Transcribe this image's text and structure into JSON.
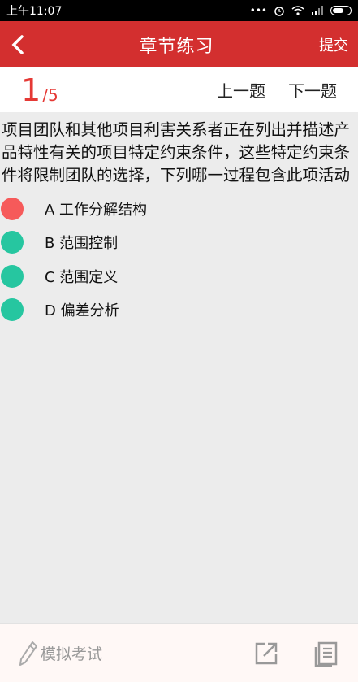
{
  "status": {
    "time": "上午11:07",
    "signal_dots": "•••"
  },
  "header": {
    "title": "章节练习",
    "submit_label": "提交",
    "back_icon": "chevron-left-icon"
  },
  "nav": {
    "current": "1",
    "separator": "/",
    "total": "5",
    "prev_label": "上一题",
    "next_label": "下一题"
  },
  "question": {
    "text": "项目团队和其他项目利害关系者正在列出并描述产品特性有关的项目特定约束条件，这些特定约束条件将限制团队的选择，下列哪一过程包含此项活动"
  },
  "options": [
    {
      "label": "A 工作分解结构",
      "selected": true
    },
    {
      "label": "B 范围控制",
      "selected": false
    },
    {
      "label": "C 范围定义",
      "selected": false
    },
    {
      "label": "D 偏差分析",
      "selected": false
    }
  ],
  "footer": {
    "mock_exam_label": "模拟考试",
    "share_icon": "share-icon",
    "list_icon": "list-icon"
  },
  "colors": {
    "primary": "#d32f2f",
    "option_default": "#26c6a0",
    "option_selected": "#f65a5a"
  }
}
